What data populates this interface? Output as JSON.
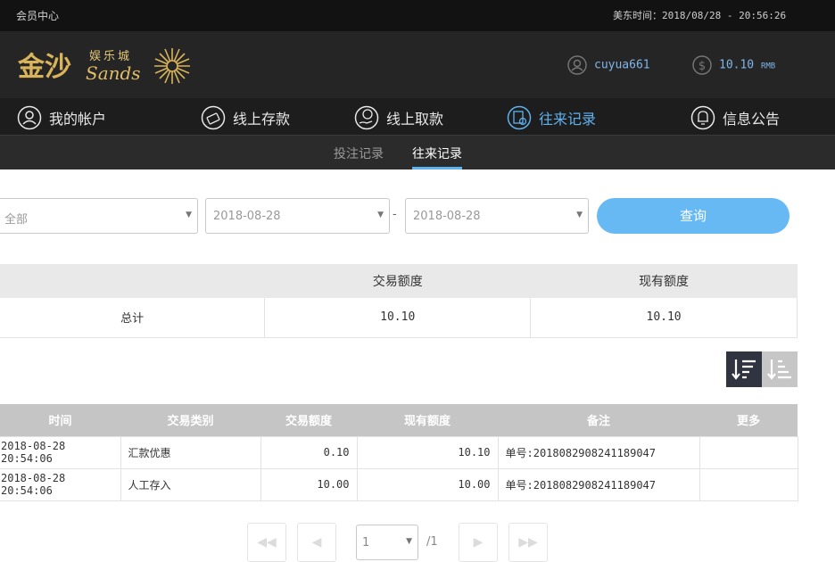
{
  "topbar": {
    "left": "会员中心",
    "right": "美东时间：2018/08/28 - 20:56:26"
  },
  "header": {
    "logo_text": "金沙",
    "logo_sub": "娱乐城",
    "logo_en": "Sands",
    "username": "cuyua661",
    "balance": "10.10",
    "currency": "RMB"
  },
  "nav": [
    {
      "label": "我的帐户",
      "icon": "user-icon"
    },
    {
      "label": "线上存款",
      "icon": "deposit-icon"
    },
    {
      "label": "线上取款",
      "icon": "withdraw-icon"
    },
    {
      "label": "往来记录",
      "icon": "records-icon",
      "active": true
    },
    {
      "label": "信息公告",
      "icon": "bell-icon"
    }
  ],
  "subnav": {
    "tab1": "投注记录",
    "tab2": "往来记录"
  },
  "filters": {
    "type": "全部",
    "date_from": "2018-08-28",
    "date_sep": "-",
    "date_to": "2018-08-28",
    "query": "查询"
  },
  "summary": {
    "headers": [
      "",
      "交易额度",
      "现有额度"
    ],
    "row": [
      "总计",
      "10.10",
      "10.10"
    ]
  },
  "list": {
    "headers": [
      "时间",
      "交易类别",
      "交易额度",
      "现有额度",
      "备注",
      "更多"
    ],
    "rows": [
      [
        "2018-08-28 20:54:06",
        "汇款优惠",
        "0.10",
        "10.10",
        "单号:2018082908241189047",
        ""
      ],
      [
        "2018-08-28 20:54:06",
        "人工存入",
        "10.00",
        "10.00",
        "单号:2018082908241189047",
        ""
      ]
    ]
  },
  "pagination": {
    "page": "1",
    "total": "/1",
    "first": "◀◀",
    "prev": "◀",
    "next": "▶",
    "last": "▶▶"
  },
  "colors": {
    "accent": "#5fb2ee",
    "button": "#67b9f3",
    "gold": "#d9b45a"
  }
}
